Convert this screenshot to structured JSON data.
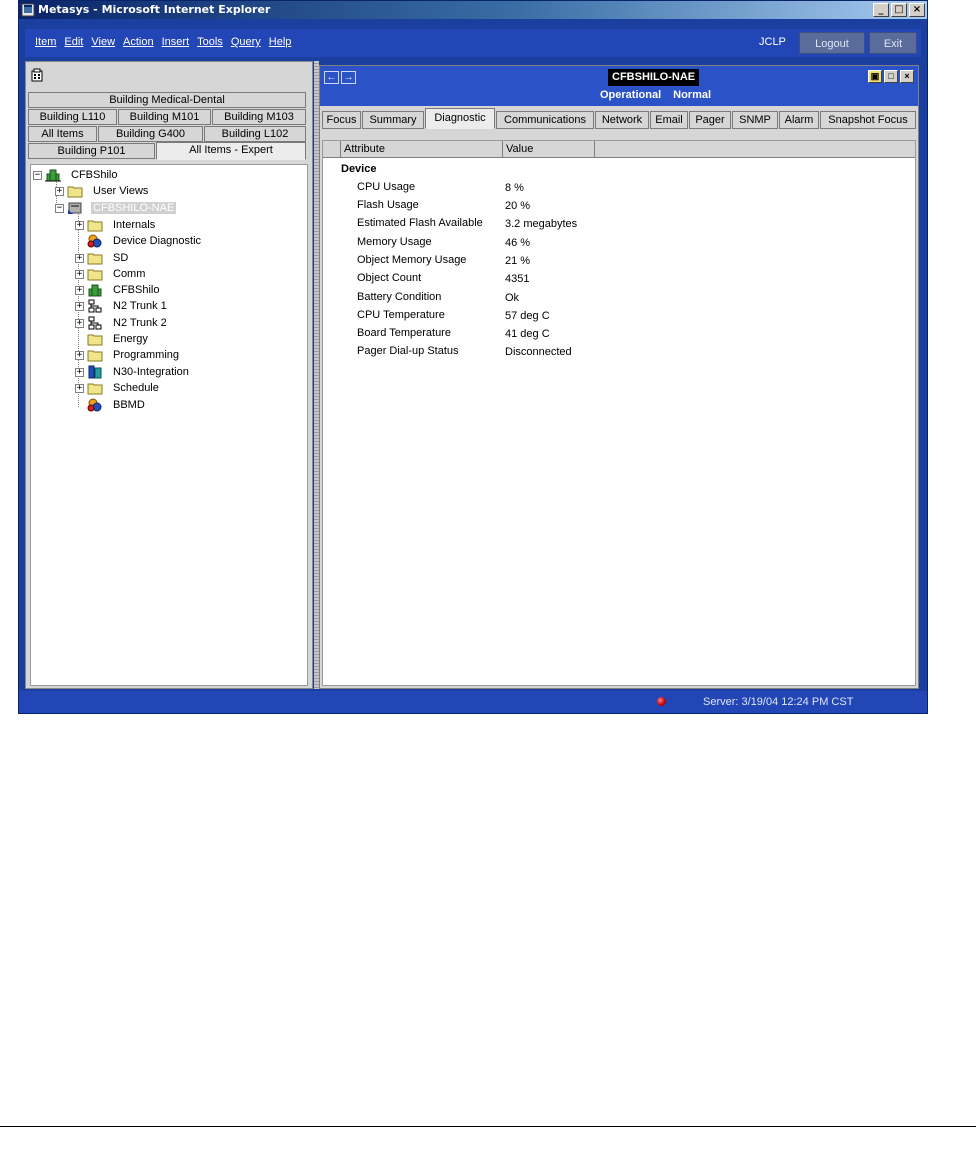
{
  "window": {
    "title": "Metasys - Microsoft Internet Explorer",
    "controls": {
      "minimize": "_",
      "maximize": "□",
      "close": "×"
    }
  },
  "menubar": {
    "items": [
      "Item",
      "Edit",
      "View",
      "Action",
      "Insert",
      "Tools",
      "Query",
      "Help"
    ],
    "user": "JCLP",
    "logout_label": "Logout",
    "exit_label": "Exit"
  },
  "left_tabs": [
    "Building Medical-Dental",
    "Building L110",
    "Building M101",
    "Building M103",
    "All Items",
    "Building G400",
    "Building L102",
    "Building P101",
    "All Items - Expert"
  ],
  "tree": {
    "root": "CFBShilo",
    "user_views": "User Views",
    "selected_device": "CFBSHILO-NAE",
    "children": [
      "Internals",
      "Device Diagnostic",
      "SD",
      "Comm",
      "CFBShilo",
      "N2 Trunk 1",
      "N2 Trunk 2",
      "Energy",
      "Programming",
      "N30-Integration",
      "Schedule",
      "BBMD"
    ]
  },
  "object": {
    "name": "CFBSHILO-NAE",
    "status": "Operational",
    "condition": "Normal"
  },
  "tabs": [
    "Focus",
    "Summary",
    "Diagnostic",
    "Communications",
    "Network",
    "Email",
    "Pager",
    "SNMP",
    "Alarm",
    "Snapshot Focus"
  ],
  "table": {
    "col_attribute": "Attribute",
    "col_value": "Value",
    "section": "Device",
    "rows": [
      {
        "attr": "CPU Usage",
        "value": "8 %"
      },
      {
        "attr": "Flash Usage",
        "value": "20 %"
      },
      {
        "attr": "Estimated Flash Available",
        "value": "3.2 megabytes"
      },
      {
        "attr": "Memory Usage",
        "value": "46 %"
      },
      {
        "attr": "Object Memory Usage",
        "value": "21 %"
      },
      {
        "attr": "Object Count",
        "value": "4351"
      },
      {
        "attr": "Battery Condition",
        "value": "Ok"
      },
      {
        "attr": "CPU Temperature",
        "value": "57 deg C"
      },
      {
        "attr": "Board Temperature",
        "value": "41 deg C"
      },
      {
        "attr": "Pager Dial-up Status",
        "value": "Disconnected"
      }
    ]
  },
  "statusbar": {
    "server": "Server: 3/19/04 12:24 PM CST"
  },
  "colors": {
    "app_blue": "#2346b6",
    "header_blue": "#2b52c6",
    "status_led": "#c00000"
  }
}
